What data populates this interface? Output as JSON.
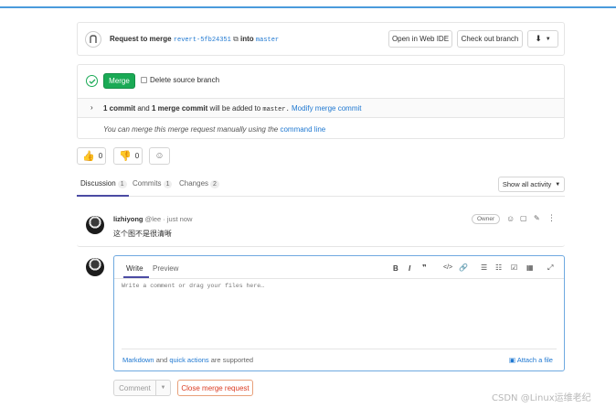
{
  "header": {
    "request_text": "Request to merge",
    "source_branch": "revert-5fb24351",
    "into_text": "into",
    "target_branch": "master",
    "open_web_ide": "Open in Web IDE",
    "checkout_branch": "Check out branch"
  },
  "merge_widget": {
    "merge_button": "Merge",
    "delete_source_label": "Delete source branch",
    "commit_count": "1 commit",
    "and_text": "and",
    "merge_commit_count": "1 merge commit",
    "will_be_added": "will be added to",
    "target": "master.",
    "modify_link": "Modify merge commit",
    "manual_text": "You can merge this merge request manually using the",
    "command_line_link": "command line"
  },
  "reactions": {
    "thumbsup_count": "0",
    "thumbsdown_count": "0"
  },
  "tabs": [
    {
      "label": "Discussion",
      "count": "1"
    },
    {
      "label": "Commits",
      "count": "1"
    },
    {
      "label": "Changes",
      "count": "2"
    }
  ],
  "activity_filter": "Show all activity",
  "note": {
    "author": "lizhiyong",
    "username": "@lee",
    "time": "· just now",
    "role": "Owner",
    "body": "这个图不是很清晰"
  },
  "editor": {
    "tab_write": "Write",
    "tab_preview": "Preview",
    "placeholder": "Write a comment or drag your files here…",
    "footer_markdown": "Markdown",
    "footer_and": "and",
    "footer_quick_actions": "quick actions",
    "footer_supported": "are supported",
    "attach_file": "Attach a file"
  },
  "actions": {
    "comment_button": "Comment",
    "close_mr_button": "Close merge request"
  },
  "watermark": "CSDN @Linux运维老纪",
  "colors": {
    "accent": "#1f78d1",
    "merge_green": "#1aaa55",
    "close_orange": "#db3b21",
    "top_line": "#4a9bdc"
  }
}
